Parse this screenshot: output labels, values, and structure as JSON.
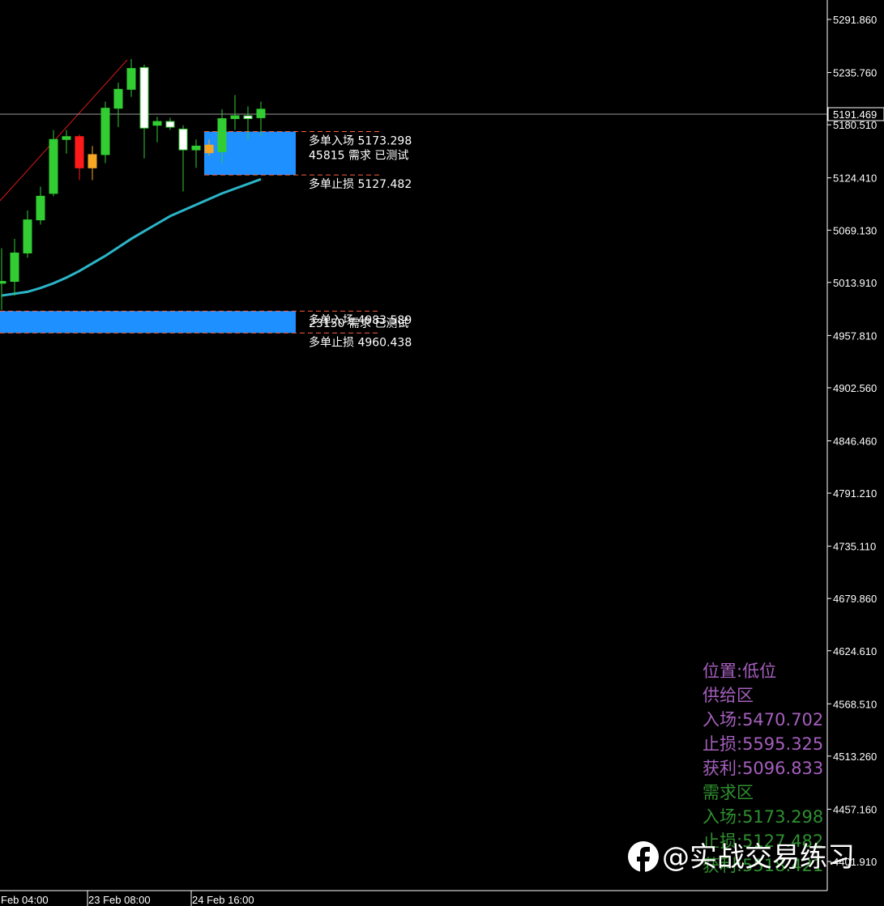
{
  "colors": {
    "background": "#000000",
    "grid_axis": "#ffffff",
    "bull_candle": "#32cd32",
    "bear_candle_body": "#ffffff",
    "wick": "#32cd32",
    "red_candle": "#ff1a1a",
    "orange_candle": "#f5a623",
    "demand_zone": "#1e90ff",
    "zone_border": "#ff6040",
    "moving_average": "#2bb5c8",
    "trendline": "#d81818",
    "current_price_line": "#9a9a9a",
    "info_purple": "#a55fbd",
    "info_green": "#2f8f2f"
  },
  "chart_data": {
    "type": "candlestick",
    "y_axis_ticks": [
      "5291.860",
      "5235.760",
      "5180.510",
      "5124.410",
      "5069.130",
      "5013.910",
      "4957.810",
      "4902.560",
      "4846.460",
      "4791.210",
      "4735.110",
      "4679.860",
      "4624.610",
      "4568.510",
      "4513.260",
      "4457.160",
      "4401.910"
    ],
    "ylim": [
      4401.91,
      5291.86
    ],
    "current_price": "5191.469",
    "x_axis_labels": [
      "Feb 04:00",
      "23 Feb 08:00",
      "24 Feb 16:00"
    ],
    "candles": [
      {
        "o": 5013,
        "h": 5050,
        "l": 4985,
        "c": 5015
      },
      {
        "o": 5015,
        "h": 5060,
        "l": 5000,
        "c": 5045
      },
      {
        "o": 5045,
        "h": 5090,
        "l": 5040,
        "c": 5080
      },
      {
        "o": 5080,
        "h": 5115,
        "l": 5075,
        "c": 5105
      },
      {
        "o": 5108,
        "h": 5175,
        "l": 5105,
        "c": 5165
      },
      {
        "o": 5165,
        "h": 5175,
        "l": 5150,
        "c": 5168
      },
      {
        "o": 5168,
        "h": 5170,
        "l": 5122,
        "c": 5135
      },
      {
        "o": 5135,
        "h": 5158,
        "l": 5122,
        "c": 5149
      },
      {
        "o": 5149,
        "h": 5205,
        "l": 5140,
        "c": 5198
      },
      {
        "o": 5198,
        "h": 5225,
        "l": 5178,
        "c": 5218
      },
      {
        "o": 5218,
        "h": 5250,
        "l": 5210,
        "c": 5240
      },
      {
        "o": 5241,
        "h": 5244,
        "l": 5145,
        "c": 5177
      },
      {
        "o": 5180,
        "h": 5189,
        "l": 5162,
        "c": 5184
      },
      {
        "o": 5184,
        "h": 5188,
        "l": 5175,
        "c": 5178
      },
      {
        "o": 5176,
        "h": 5180,
        "l": 5110,
        "c": 5154
      },
      {
        "o": 5154,
        "h": 5165,
        "l": 5135,
        "c": 5158
      },
      {
        "o": 5159,
        "h": 5165,
        "l": 5148,
        "c": 5151
      },
      {
        "o": 5152,
        "h": 5197,
        "l": 5140,
        "c": 5187
      },
      {
        "o": 5187,
        "h": 5212,
        "l": 5175,
        "c": 5190
      },
      {
        "o": 5187,
        "h": 5200,
        "l": 5165,
        "c": 5190
      },
      {
        "o": 5188,
        "h": 5205,
        "l": 5169,
        "c": 5197
      }
    ],
    "candle_colors": [
      "bull",
      "bull",
      "bull",
      "bull",
      "bull",
      "bull",
      "red",
      "orange",
      "bull",
      "bull",
      "bull",
      "white",
      "bull",
      "white",
      "white",
      "bull",
      "orange",
      "bull",
      "bull",
      "white",
      "bull"
    ],
    "moving_average": [
      5000,
      5002,
      5004,
      5008,
      5013,
      5019,
      5026,
      5034,
      5042,
      5051,
      5060,
      5068,
      5076,
      5084,
      5090,
      5096,
      5102,
      5108,
      5113,
      5118,
      5123
    ],
    "zones": [
      {
        "type": "demand",
        "top": 5173.298,
        "bottom": 5127.482,
        "label_entry": "多单入场 5173.298",
        "label_status": "45815 需求 已测试",
        "label_stop": "多单止损 5127.482"
      },
      {
        "type": "demand",
        "top": 4983.589,
        "bottom": 4960.438,
        "label_entry": "多单入场 4983.589",
        "label_status": "23150 需求 已测试",
        "label_stop": "多单止损 4960.438"
      }
    ]
  },
  "info_panel": {
    "position": "位置:低位",
    "supply_title": "供给区",
    "supply_entry": "入场:5470.702",
    "supply_stop": "止损:5595.325",
    "supply_target": "获利:5096.833",
    "demand_title": "需求区",
    "demand_entry": "入场:5173.298",
    "demand_stop": "止损:5127.482",
    "demand_target": "获利:5518.421"
  },
  "watermark": {
    "text": "@实战交易练习",
    "icon": "facebook-f-icon"
  }
}
